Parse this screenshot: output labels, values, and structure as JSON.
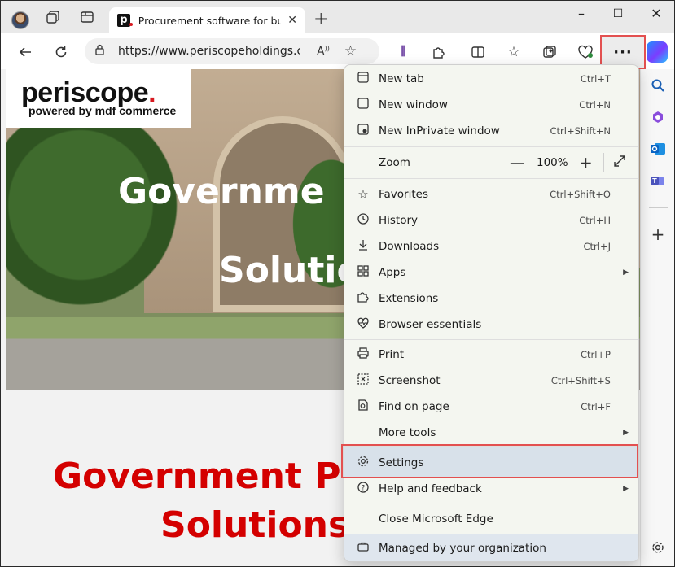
{
  "browser": {
    "tab_title": "Procurement software for buyers",
    "tab_close": "✕",
    "new_tab": "+",
    "url": "https://www.periscopeholdings.co...",
    "window": {
      "minimize": "–",
      "maximize": "☐",
      "close": "✕"
    },
    "more_label": "···"
  },
  "page": {
    "logo_main": "periscope",
    "logo_dot": ".",
    "logo_sub": "powered by mdf commerce",
    "hero_line1": "Governme",
    "hero_line2": "Solutio",
    "red_line1": "Government Pr",
    "red_line2": "Solutions"
  },
  "menu": {
    "items": [
      {
        "label": "New tab",
        "shortcut": "Ctrl+T"
      },
      {
        "label": "New window",
        "shortcut": "Ctrl+N"
      },
      {
        "label": "New InPrivate window",
        "shortcut": "Ctrl+Shift+N"
      },
      {
        "label": "Favorites",
        "shortcut": "Ctrl+Shift+O"
      },
      {
        "label": "History",
        "shortcut": "Ctrl+H"
      },
      {
        "label": "Downloads",
        "shortcut": "Ctrl+J"
      },
      {
        "label": "Apps",
        "shortcut": ""
      },
      {
        "label": "Extensions",
        "shortcut": ""
      },
      {
        "label": "Browser essentials",
        "shortcut": ""
      },
      {
        "label": "Print",
        "shortcut": "Ctrl+P"
      },
      {
        "label": "Screenshot",
        "shortcut": "Ctrl+Shift+S"
      },
      {
        "label": "Find on page",
        "shortcut": "Ctrl+F"
      },
      {
        "label": "More tools",
        "shortcut": ""
      },
      {
        "label": "Settings",
        "shortcut": ""
      },
      {
        "label": "Help and feedback",
        "shortcut": ""
      },
      {
        "label": "Close Microsoft Edge",
        "shortcut": ""
      },
      {
        "label": "Managed by your organization",
        "shortcut": ""
      }
    ],
    "zoom": {
      "label": "Zoom",
      "value": "100%",
      "minus": "—",
      "plus": "+"
    }
  },
  "colors": {
    "highlight_border": "#e35050",
    "brand_red": "#d40000",
    "settings_bg": "#d8e1ea"
  },
  "icons": [
    "profile-avatar",
    "workspaces-icon",
    "tab-actions-icon",
    "back-icon",
    "refresh-icon",
    "lock-icon",
    "read-aloud-icon",
    "favorite-star-icon",
    "copilot-icon",
    "search-icon",
    "outlook-icon",
    "teams-icon",
    "plus-icon",
    "gear-icon"
  ]
}
